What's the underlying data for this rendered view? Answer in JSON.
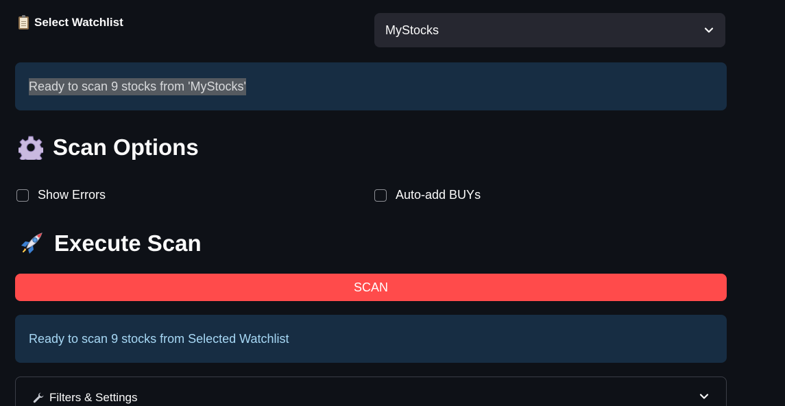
{
  "watchlist": {
    "label": "Select Watchlist",
    "selected": "MyStocks"
  },
  "info_top": "Ready to scan 9 stocks from 'MyStocks'",
  "scan_options": {
    "title": "Scan Options",
    "show_errors": {
      "label": "Show Errors",
      "checked": false
    },
    "auto_add": {
      "label": "Auto-add BUYs",
      "checked": false
    }
  },
  "execute": {
    "title": "Execute Scan",
    "button_label": "SCAN"
  },
  "info_bottom": "Ready to scan 9 stocks from Selected Watchlist",
  "filters": {
    "title": "Filters & Settings"
  },
  "colors": {
    "background": "#0e1117",
    "info_bg": "#172d43",
    "info_text": "#a7d8f5",
    "primary_button": "#ff4b4b",
    "select_bg": "#262730"
  },
  "icons": {
    "watchlist": "clipboard-icon",
    "scan_options": "gear-icon",
    "execute": "rocket-icon",
    "filters": "wrench-icon",
    "select": "chevron-down-icon"
  }
}
